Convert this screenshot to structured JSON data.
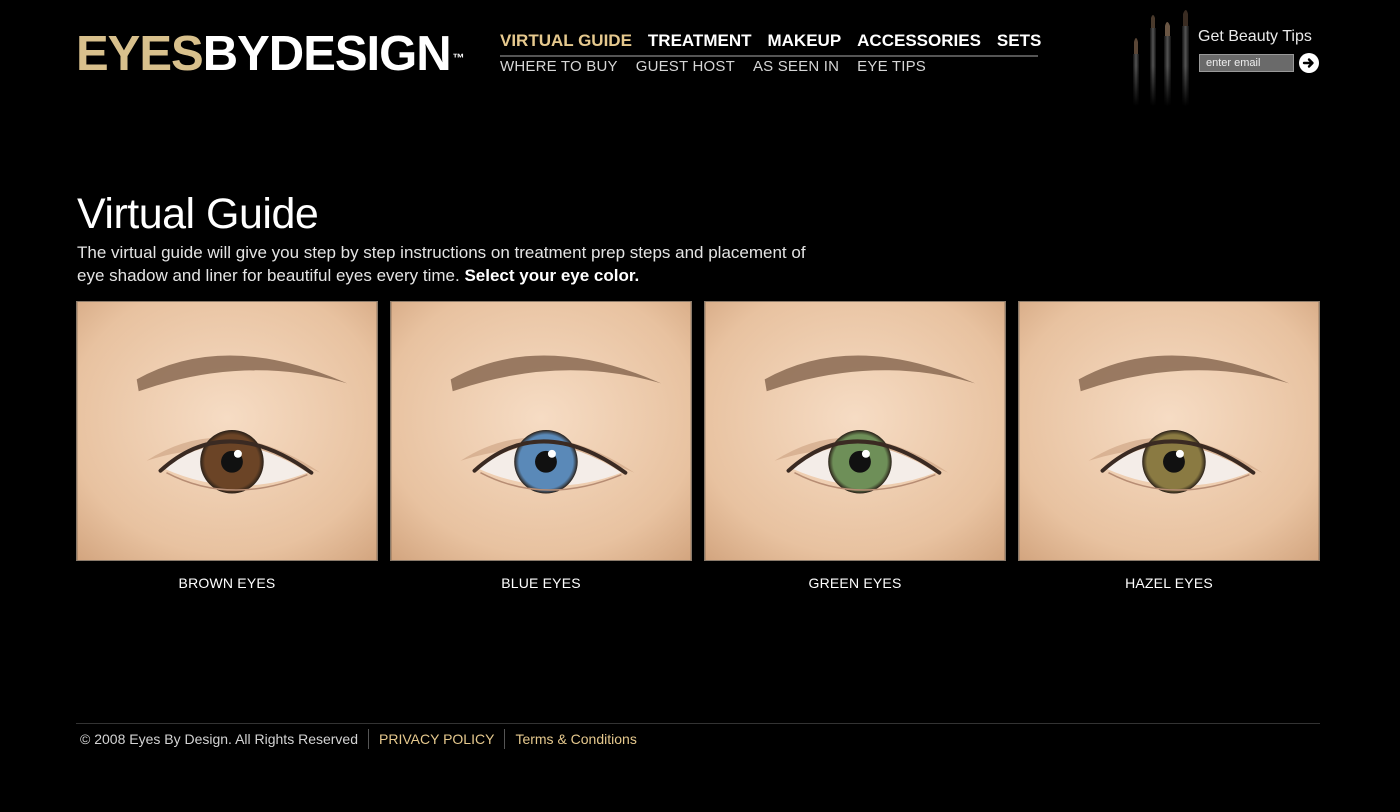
{
  "brand": {
    "logo_part1": "EYES",
    "logo_part2": "BYDESIGN",
    "trademark": "™",
    "accent_color": "#e6c98e"
  },
  "nav": {
    "primary": [
      {
        "label": "VIRTUAL GUIDE",
        "active": true
      },
      {
        "label": "TREATMENT",
        "active": false
      },
      {
        "label": "MAKEUP",
        "active": false
      },
      {
        "label": "ACCESSORIES",
        "active": false
      },
      {
        "label": "SETS",
        "active": false
      }
    ],
    "secondary": [
      {
        "label": "WHERE TO BUY"
      },
      {
        "label": "GUEST HOST"
      },
      {
        "label": "AS SEEN IN"
      },
      {
        "label": "EYE TIPS"
      }
    ]
  },
  "newsletter": {
    "title": "Get Beauty Tips",
    "placeholder": "enter email",
    "submit_icon": "arrow-right-circle-icon"
  },
  "main": {
    "title": "Virtual Guide",
    "intro": "The virtual guide will give you step by step instructions on treatment prep steps and placement of eye shadow and liner for beautiful eyes every time.",
    "intro_emphasis": "Select your eye color.",
    "eyes": [
      {
        "label": "BROWN EYES",
        "iris_color": "#6b4426"
      },
      {
        "label": "BLUE EYES",
        "iris_color": "#5a89b8"
      },
      {
        "label": "GREEN EYES",
        "iris_color": "#6e8f58"
      },
      {
        "label": "HAZEL EYES",
        "iris_color": "#8a7a42"
      }
    ]
  },
  "footer": {
    "copyright": "© 2008 Eyes By Design. All Rights Reserved",
    "privacy": "PRIVACY POLICY",
    "terms": "Terms & Conditions"
  }
}
